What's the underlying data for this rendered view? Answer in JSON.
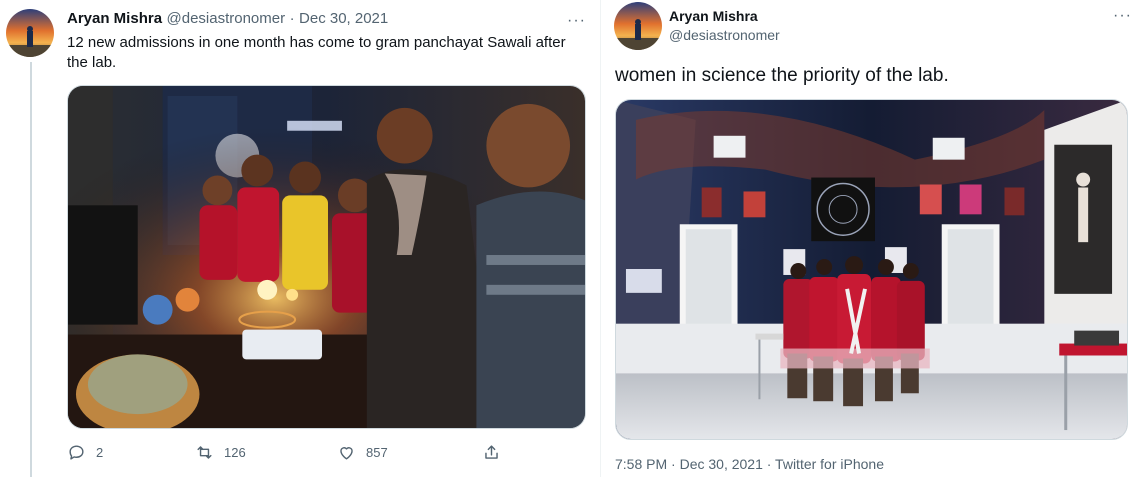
{
  "left_tweet": {
    "author_name": "Aryan Mishra",
    "handle": "@desiastronomer",
    "separator": "·",
    "date": "Dec 30, 2021",
    "more_label": "···",
    "text": "12 new admissions in one month has come to gram panchayat Sawali after the lab.",
    "replies": "2",
    "retweets": "126",
    "likes": "857"
  },
  "right_tweet": {
    "author_name": "Aryan Mishra",
    "handle": "@desiastronomer",
    "more_label": "···",
    "text": "women in science the priority of the lab.",
    "timestamp": "7:58 PM · Dec 30, 2021 · Twitter for iPhone"
  },
  "icons": {
    "reply": "reply-icon",
    "retweet": "retweet-icon",
    "like": "heart-icon",
    "share": "share-icon",
    "more": "more-icon"
  },
  "colors": {
    "text_primary": "#0f1419",
    "text_secondary": "#536471",
    "border": "#cfd9de",
    "uniform_red": "#c0152f"
  }
}
